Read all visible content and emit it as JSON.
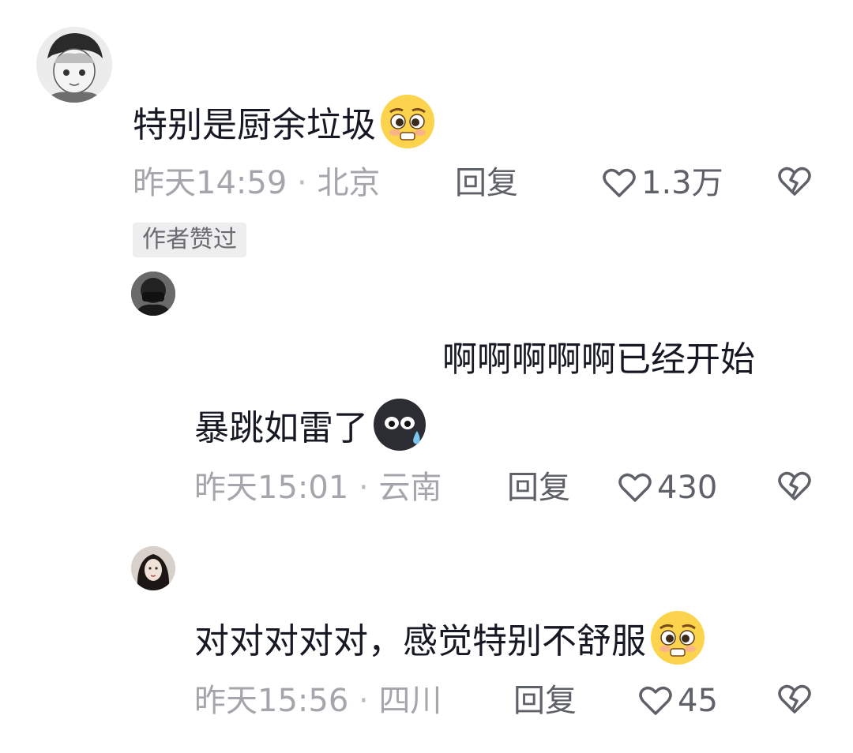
{
  "comments": [
    {
      "text": "特别是厨余垃圾",
      "emoji": "pleading-face-emoji",
      "time": "昨天14:59",
      "location": "北京",
      "reply": "回复",
      "likes": "1.3万",
      "badge": "作者赞过"
    },
    {
      "text_line1": "啊啊啊啊啊已经开始",
      "text_line2": "暴跳如雷了",
      "emoji": "sweat-blob-emoji",
      "time": "昨天15:01",
      "location": "云南",
      "reply": "回复",
      "likes": "430"
    },
    {
      "text": "对对对对对，感觉特别不舒服",
      "emoji": "pleading-face-emoji",
      "time": "昨天15:56",
      "location": "四川",
      "reply": "回复",
      "likes": "45"
    }
  ],
  "separator": "·",
  "colors": {
    "text": "#161823",
    "meta": "#a4a6ab",
    "action": "#5f6168",
    "badge_bg": "#eeeeef",
    "emoji_yellow": "#fcd34d"
  }
}
